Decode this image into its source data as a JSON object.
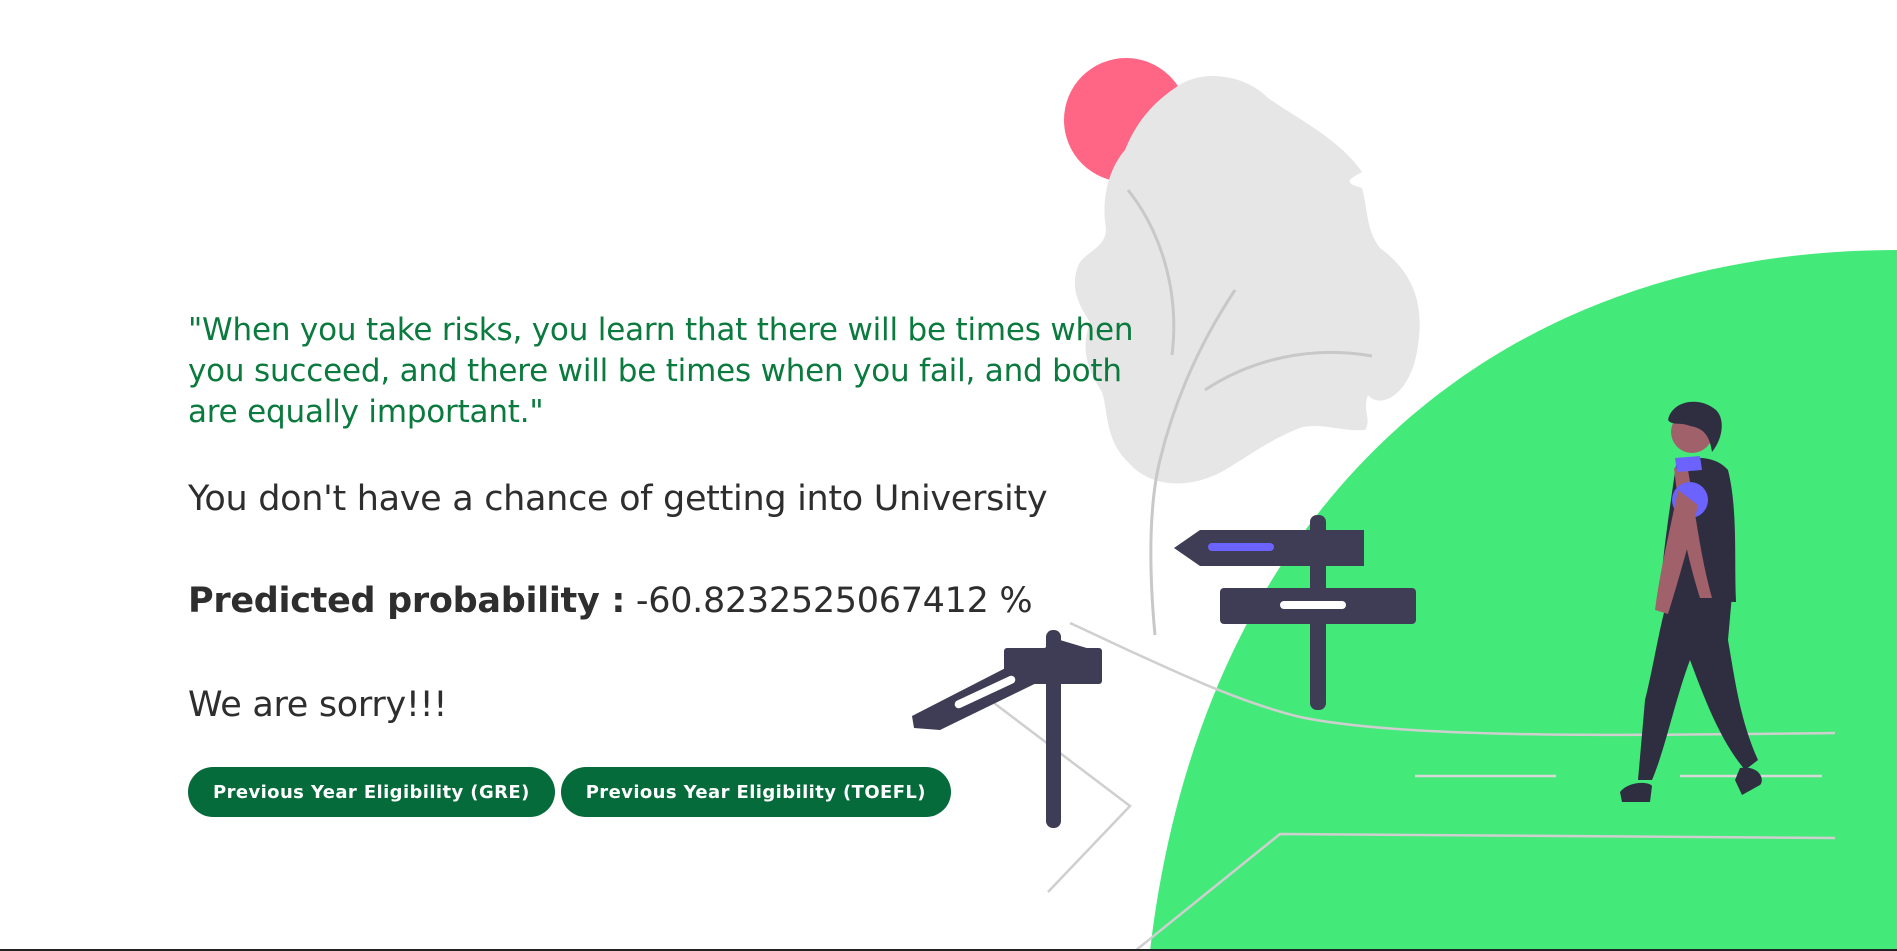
{
  "quote": "\"When you take risks, you learn that there will be times when you succeed, and there will be times when you fail, and both are equally important.\"",
  "result_message": "You don't have a chance of getting into University",
  "probability": {
    "label": "Predicted probability :",
    "value": "-60.8232525067412 %"
  },
  "closing_message": "We are sorry!!!",
  "buttons": {
    "gre_label": "Previous Year Eligibility (GRE)",
    "toefl_label": "Previous Year Eligibility (TOEFL)"
  },
  "colors": {
    "quote_green": "#0b7a3e",
    "button_green": "#056b3b",
    "hill_green": "#43ea79",
    "sun_pink": "#ff6584",
    "sign_dark": "#3f3d56",
    "accent_purple": "#6c63ff"
  },
  "illustration": {
    "icons": [
      "tree-icon",
      "sun-icon",
      "signpost-icon",
      "walking-person-icon"
    ]
  }
}
